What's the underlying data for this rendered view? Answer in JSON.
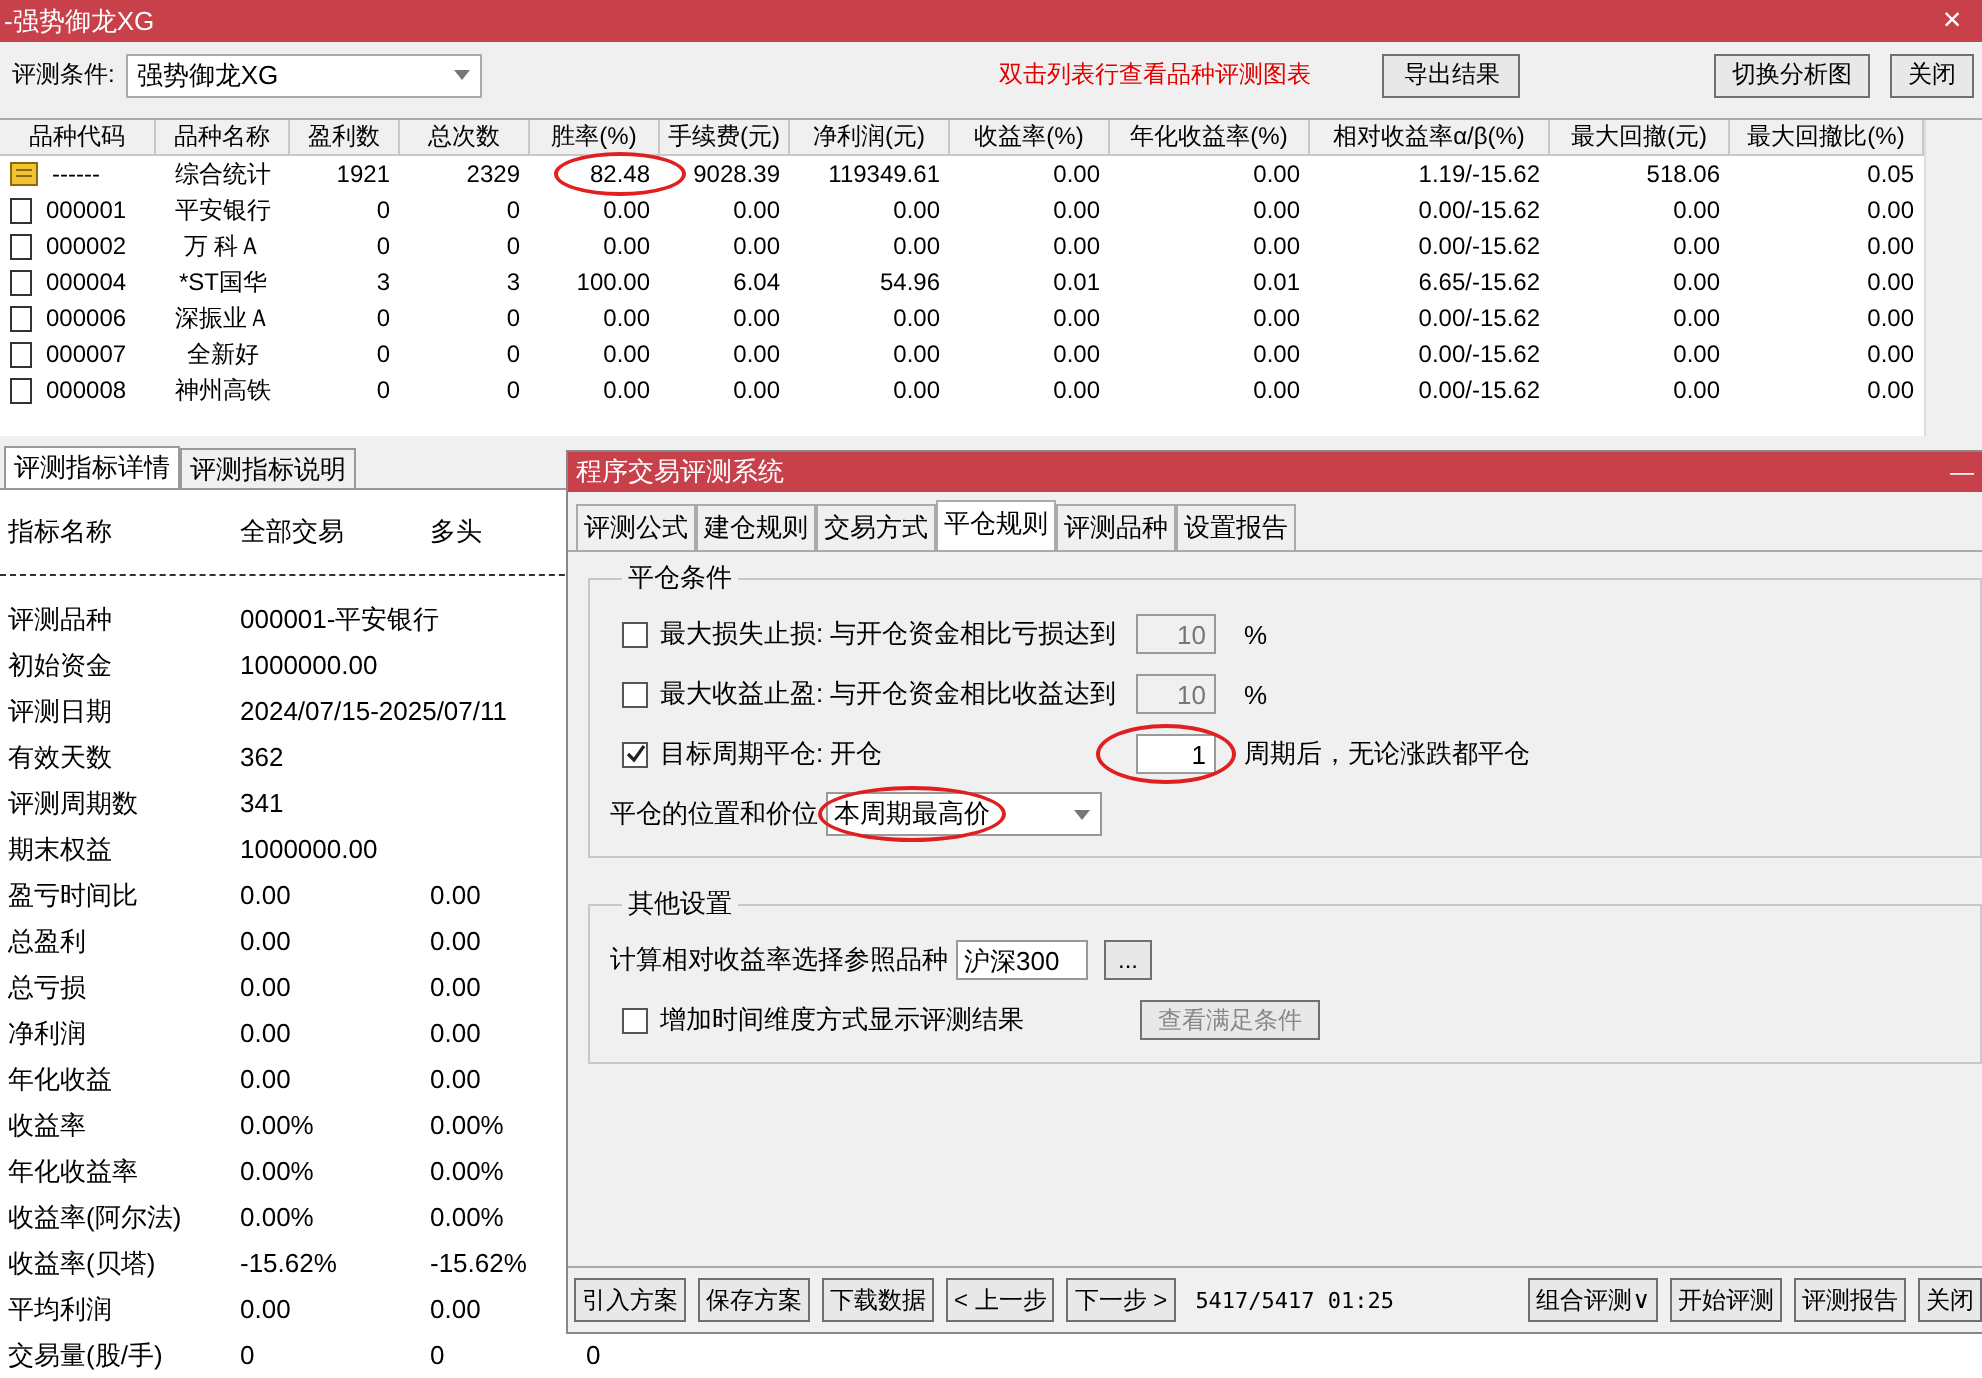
{
  "window": {
    "title": "-强势御龙XG",
    "close": "×"
  },
  "toolbar": {
    "condition_label": "评测条件:",
    "condition_value": "强势御龙XG",
    "hint": "双击列表行查看品种评测图表",
    "export_button": "导出结果",
    "buttons": [
      "切换分析图",
      "关闭"
    ]
  },
  "table": {
    "columns": [
      "品种代码",
      "品种名称",
      "盈利数",
      "总次数",
      "胜率(%)",
      "手续费(元)",
      "净利润(元)",
      "收益率(%)",
      "年化收益率(%)",
      "相对收益率α/β(%)",
      "最大回撤(元)",
      "最大回撤比(%)"
    ],
    "rows": [
      {
        "kind": "summary",
        "cells": [
          "------",
          "综合统计",
          "1921",
          "2329",
          "82.48",
          "9028.39",
          "119349.61",
          "0.00",
          "0.00",
          "1.19/-15.62",
          "518.06",
          "0.05"
        ],
        "circled": [
          false,
          false,
          false,
          false,
          true,
          false,
          false,
          false,
          false,
          false,
          false,
          false
        ]
      },
      {
        "kind": "stock",
        "cells": [
          "000001",
          "平安银行",
          "0",
          "0",
          "0.00",
          "0.00",
          "0.00",
          "0.00",
          "0.00",
          "0.00/-15.62",
          "0.00",
          "0.00"
        ]
      },
      {
        "kind": "stock",
        "cells": [
          "000002",
          "万 科Ａ",
          "0",
          "0",
          "0.00",
          "0.00",
          "0.00",
          "0.00",
          "0.00",
          "0.00/-15.62",
          "0.00",
          "0.00"
        ]
      },
      {
        "kind": "stock",
        "cells": [
          "000004",
          "*ST国华",
          "3",
          "3",
          "100.00",
          "6.04",
          "54.96",
          "0.01",
          "0.01",
          "6.65/-15.62",
          "0.00",
          "0.00"
        ]
      },
      {
        "kind": "stock",
        "cells": [
          "000006",
          "深振业Ａ",
          "0",
          "0",
          "0.00",
          "0.00",
          "0.00",
          "0.00",
          "0.00",
          "0.00/-15.62",
          "0.00",
          "0.00"
        ]
      },
      {
        "kind": "stock",
        "cells": [
          "000007",
          "全新好",
          "0",
          "0",
          "0.00",
          "0.00",
          "0.00",
          "0.00",
          "0.00",
          "0.00/-15.62",
          "0.00",
          "0.00"
        ]
      },
      {
        "kind": "stock",
        "cells": [
          "000008",
          "神州高铁",
          "0",
          "0",
          "0.00",
          "0.00",
          "0.00",
          "0.00",
          "0.00",
          "0.00/-15.62",
          "0.00",
          "0.00"
        ]
      }
    ]
  },
  "details": {
    "tabs": [
      {
        "label": "评测指标详情",
        "selected": true
      },
      {
        "label": "评测指标说明",
        "selected": false
      }
    ],
    "header": [
      "指标名称",
      "全部交易",
      "多头"
    ],
    "rows": [
      {
        "name": "评测品种",
        "values": [
          "000001-平安银行"
        ]
      },
      {
        "name": "初始资金",
        "values": [
          "1000000.00"
        ]
      },
      {
        "name": "评测日期",
        "values": [
          "2024/07/15-2025/07/11"
        ]
      },
      {
        "name": "有效天数",
        "values": [
          "362"
        ]
      },
      {
        "name": "评测周期数",
        "values": [
          "341"
        ]
      },
      {
        "name": "期末权益",
        "values": [
          "1000000.00"
        ]
      },
      {
        "name": "盈亏时间比",
        "values": [
          "0.00",
          "0.00"
        ]
      },
      {
        "name": "总盈利",
        "values": [
          "0.00",
          "0.00"
        ]
      },
      {
        "name": "总亏损",
        "values": [
          "0.00",
          "0.00"
        ]
      },
      {
        "name": "净利润",
        "values": [
          "0.00",
          "0.00"
        ]
      },
      {
        "name": "年化收益",
        "values": [
          "0.00",
          "0.00"
        ]
      },
      {
        "name": "收益率",
        "values": [
          "0.00%",
          "0.00%"
        ]
      },
      {
        "name": "年化收益率",
        "values": [
          "0.00%",
          "0.00%"
        ]
      },
      {
        "name": "收益率(阿尔法)",
        "values": [
          "0.00%",
          "0.00%"
        ]
      },
      {
        "name": "收益率(贝塔)",
        "values": [
          "-15.62%",
          "-15.62%"
        ]
      },
      {
        "name": "平均利润",
        "values": [
          "0.00",
          "0.00"
        ]
      },
      {
        "name": "交易量(股/手)",
        "values": [
          "0",
          "0",
          "0"
        ]
      }
    ]
  },
  "dialog": {
    "title": "程序交易评测系统",
    "minimize": "—",
    "tabs": [
      {
        "label": "评测公式",
        "selected": false
      },
      {
        "label": "建仓规则",
        "selected": false
      },
      {
        "label": "交易方式",
        "selected": false
      },
      {
        "label": "平仓规则",
        "selected": true
      },
      {
        "label": "评测品种",
        "selected": false
      },
      {
        "label": "设置报告",
        "selected": false
      }
    ],
    "groups": [
      {
        "title": "平仓条件",
        "items": [
          {
            "kind": "check_input",
            "checked": false,
            "label": "最大损失止损: 与开仓资金相比亏损达到",
            "value": "10",
            "disabled": true,
            "unit": "%"
          },
          {
            "kind": "check_input",
            "checked": false,
            "label": "最大收益止盈: 与开仓资金相比收益达到",
            "value": "10",
            "disabled": true,
            "unit": "%"
          },
          {
            "kind": "check_input",
            "checked": true,
            "label": "目标周期平仓: 开仓",
            "value": "1",
            "disabled": false,
            "unit": "周期后，无论涨跌都平仓",
            "circled": true
          },
          {
            "kind": "select",
            "label": "平仓的位置和价位",
            "value": "本周期最高价",
            "circled": true
          }
        ]
      },
      {
        "title": "其他设置",
        "items": [
          {
            "kind": "picker",
            "label": "计算相对收益率选择参照品种",
            "value": "沪深300",
            "button": "..."
          },
          {
            "kind": "check_button",
            "checked": false,
            "label": "增加时间维度方式显示评测结果",
            "button": "查看满足条件",
            "disabled": true
          }
        ]
      }
    ],
    "left_buttons": [
      "引入方案",
      "保存方案",
      "下载数据",
      "< 上一步",
      "下一步 >"
    ],
    "status": "5417/5417 01:25",
    "right_buttons": [
      "组合评测∨",
      "开始评测",
      "评测报告",
      "关闭"
    ]
  }
}
